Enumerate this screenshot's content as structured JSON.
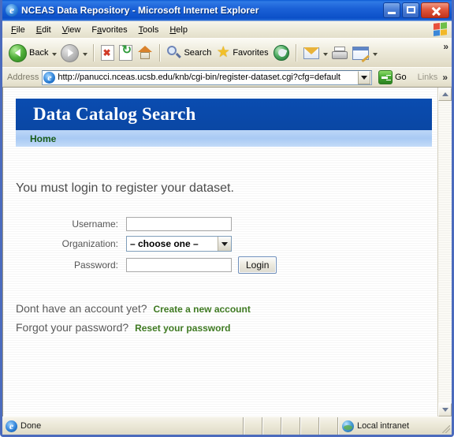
{
  "window": {
    "title": "NCEAS Data Repository - Microsoft Internet Explorer",
    "app_icon": "ie-logo-icon",
    "controls": {
      "minimize": "minimize-button",
      "maximize": "maximize-button",
      "close": "close-button"
    }
  },
  "menubar": {
    "items": [
      {
        "label": "File",
        "accel": "F"
      },
      {
        "label": "Edit",
        "accel": "E"
      },
      {
        "label": "View",
        "accel": "V"
      },
      {
        "label": "Favorites",
        "accel": "a"
      },
      {
        "label": "Tools",
        "accel": "T"
      },
      {
        "label": "Help",
        "accel": "H"
      }
    ]
  },
  "toolbar": {
    "back_label": "Back",
    "forward_label": "",
    "stop_label": "",
    "refresh_label": "",
    "home_label": "",
    "search_label": "Search",
    "favorites_label": "Favorites",
    "media_label": "",
    "mail_label": "",
    "print_label": "",
    "edit_label": "",
    "overflow_label": "»"
  },
  "addressbar": {
    "label": "Address",
    "url": "http://panucci.nceas.ucsb.edu/knb/cgi-bin/register-dataset.cgi?cfg=default",
    "placeholder": "",
    "go_label": "Go",
    "links_label": "Links",
    "overflow_label": "»"
  },
  "page": {
    "banner_title": "Data Catalog Search",
    "nav": [
      {
        "label": "Home"
      }
    ],
    "lead": "You must login to register your dataset.",
    "form": {
      "username": {
        "label": "Username:",
        "value": "",
        "placeholder": ""
      },
      "organization": {
        "label": "Organization:",
        "selected": "– choose one –"
      },
      "password": {
        "label": "Password:",
        "value": "",
        "placeholder": ""
      },
      "submit_label": "Login"
    },
    "helper": {
      "no_account_text": "Dont have an account yet?",
      "create_link": "Create a new account",
      "forgot_text": "Forgot your password?",
      "reset_link": "Reset your password"
    }
  },
  "statusbar": {
    "status": "Done",
    "zone": "Local intranet"
  },
  "colors": {
    "banner_blue": "#0a4cb0",
    "nav_blue": "#a9caf4",
    "link_green": "#3f7a22",
    "nav_link_green": "#185c18",
    "title_gradient_start": "#0b59d2",
    "close_red": "#c3331c"
  }
}
